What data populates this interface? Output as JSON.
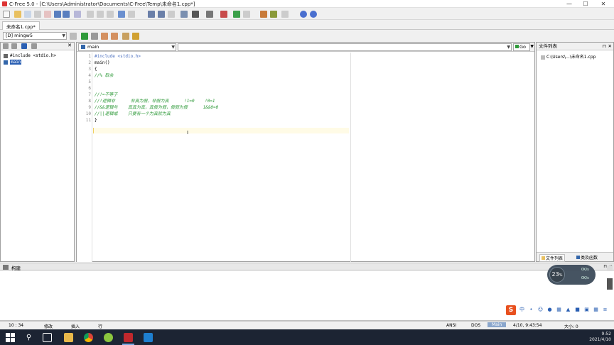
{
  "window": {
    "title": "C-Free 5.0 - [C:\\Users\\Administrator\\Documents\\C-Free\\Temp\\未命名1.cpp*]",
    "minimize": "—",
    "maximize": "☐",
    "close": "✕"
  },
  "tabs": [
    {
      "label": "未命名1.cpp*"
    }
  ],
  "compiler": {
    "selected": "[D] mingw5"
  },
  "editor_header": {
    "function_combo": "main",
    "member_combo": "",
    "go_button": "Go"
  },
  "class_tree": {
    "items": [
      {
        "label": "#include <stdio.h>"
      },
      {
        "label": "main"
      }
    ]
  },
  "code": {
    "lines": [
      {
        "num": "1",
        "text": "#include <stdio.h>"
      },
      {
        "num": "2",
        "text": "main()"
      },
      {
        "num": "3",
        "text": "{"
      },
      {
        "num": "4",
        "text": "//% 取余"
      },
      {
        "num": "5",
        "text": ""
      },
      {
        "num": "6",
        "text": ""
      },
      {
        "num": "7",
        "text": "//!=不等于"
      },
      {
        "num": "8",
        "text": "//!逻辑非      非真为假，非假为真      !1=0    !0=1"
      },
      {
        "num": "9",
        "text": "//&&逻辑与    真真为真，真假为假，假假为假      1&&0=0"
      },
      {
        "num": "10",
        "text": "//||逻辑或    只要有一个为真就为真"
      },
      {
        "num": "11",
        "text": "}"
      }
    ]
  },
  "file_list": {
    "header": "文件列表",
    "items": [
      {
        "label": "C:\\Users\\...\\未命名1.cpp"
      }
    ],
    "tab_files": "文件列表",
    "tab_classes": "类及函数"
  },
  "build": {
    "title": "构建"
  },
  "status": {
    "position": "10 : 34",
    "modified": "修改",
    "insert": "插入",
    "line": "行",
    "encoding": "ANSI",
    "eol": "DOS",
    "mode": "Main",
    "file_time": "4/10, 9:43:54",
    "size": "大小: 0"
  },
  "overlay": {
    "percent": "23",
    "unit": "%",
    "up": "0K/s",
    "down": "0K/s"
  },
  "ime": {
    "logo": "S",
    "lang": "中"
  },
  "taskbar": {
    "time": "9:52",
    "date": "2021/4/10",
    "apps": [
      "start",
      "search",
      "task-view",
      "file-explorer",
      "chrome",
      "360",
      "c-free",
      "recorder"
    ]
  },
  "colors": {
    "comment": "#2f9a3a",
    "preprocessor": "#4a6fbf",
    "selection": "#2a5fb3",
    "taskbar": "#1c2433"
  }
}
